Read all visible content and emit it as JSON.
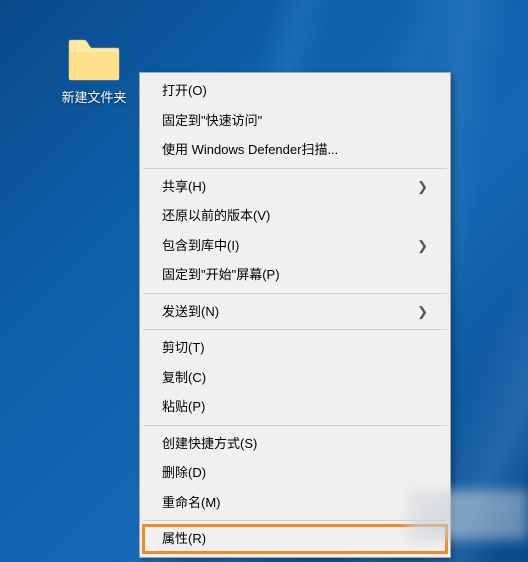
{
  "desktop": {
    "folder": {
      "label": "新建文件夹"
    }
  },
  "context_menu": {
    "groups": [
      [
        {
          "label": "打开(O)",
          "arrow": false
        },
        {
          "label": "固定到\"快速访问\"",
          "arrow": false
        },
        {
          "label": "使用 Windows Defender扫描...",
          "arrow": false
        }
      ],
      [
        {
          "label": "共享(H)",
          "arrow": true
        },
        {
          "label": "还原以前的版本(V)",
          "arrow": false
        },
        {
          "label": "包含到库中(I)",
          "arrow": true
        },
        {
          "label": "固定到\"开始\"屏幕(P)",
          "arrow": false
        }
      ],
      [
        {
          "label": "发送到(N)",
          "arrow": true
        }
      ],
      [
        {
          "label": "剪切(T)",
          "arrow": false
        },
        {
          "label": "复制(C)",
          "arrow": false
        },
        {
          "label": "粘贴(P)",
          "arrow": false
        }
      ],
      [
        {
          "label": "创建快捷方式(S)",
          "arrow": false
        },
        {
          "label": "删除(D)",
          "arrow": false
        },
        {
          "label": "重命名(M)",
          "arrow": false
        }
      ],
      [
        {
          "label": "属性(R)",
          "arrow": false,
          "highlight": true
        }
      ]
    ]
  }
}
